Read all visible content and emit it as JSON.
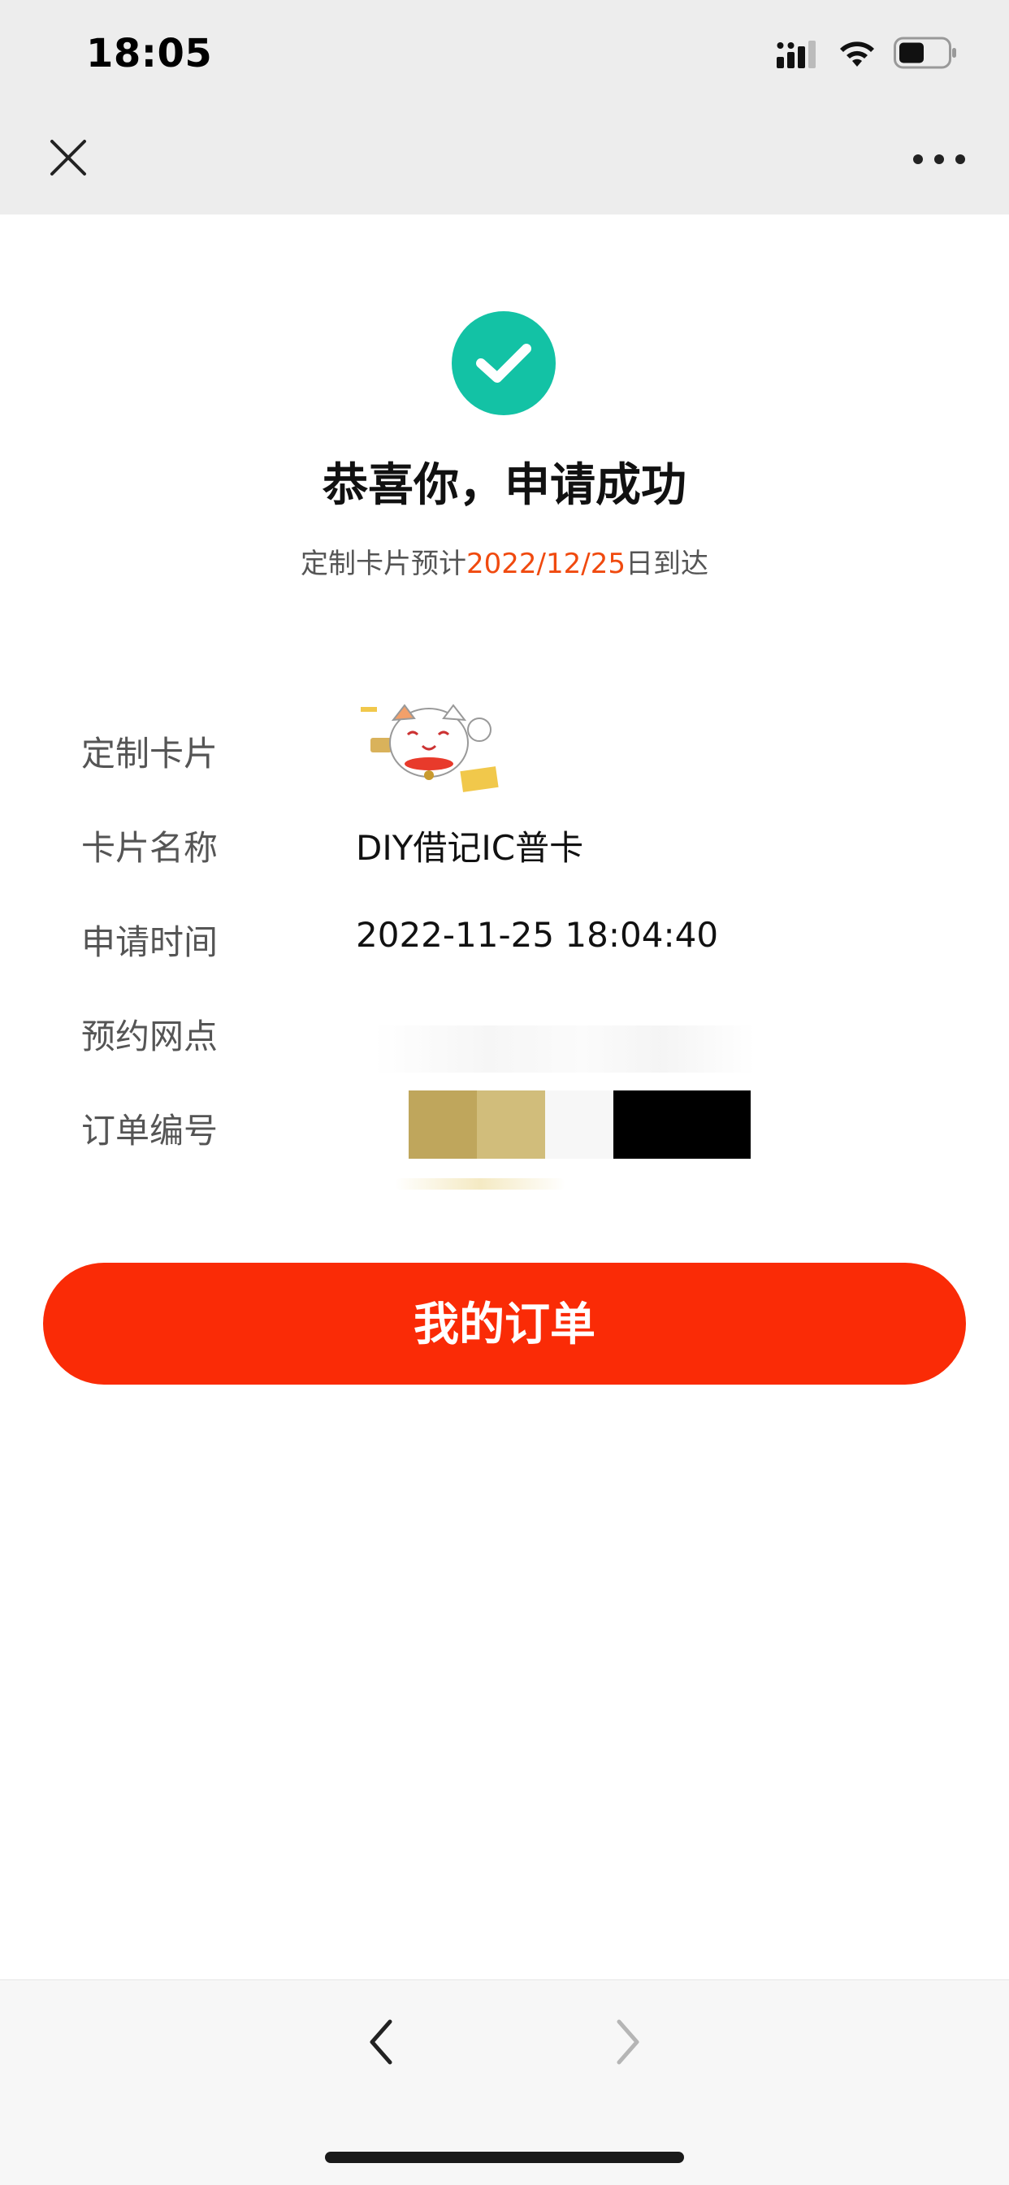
{
  "status_bar": {
    "time": "18:05",
    "icons": [
      "signal-icon",
      "wifi-icon",
      "battery-icon"
    ]
  },
  "nav": {
    "close_icon": "close-icon",
    "more_icon": "more-icon"
  },
  "result": {
    "icon": "check-circle-icon",
    "title": "恭喜你，申请成功",
    "arrival_prefix": "定制卡片预计",
    "arrival_date": "2022/12/25",
    "arrival_suffix": "日到达"
  },
  "details": {
    "rows": [
      {
        "label": "定制卡片",
        "value": ""
      },
      {
        "label": "卡片名称",
        "value": "DIY借记IC普卡"
      },
      {
        "label": "申请时间",
        "value": "2022-11-25 18:04:40"
      },
      {
        "label": "预约网点",
        "value": ""
      },
      {
        "label": "订单编号",
        "value": ""
      }
    ]
  },
  "actions": {
    "orders_label": "我的订单"
  },
  "bottom_bar": {
    "back_icon": "chevron-left-icon",
    "forward_icon": "chevron-right-icon"
  },
  "colors": {
    "accent_green": "#13c2a5",
    "accent_red": "#fa2b06",
    "date_highlight": "#f04a0f"
  }
}
